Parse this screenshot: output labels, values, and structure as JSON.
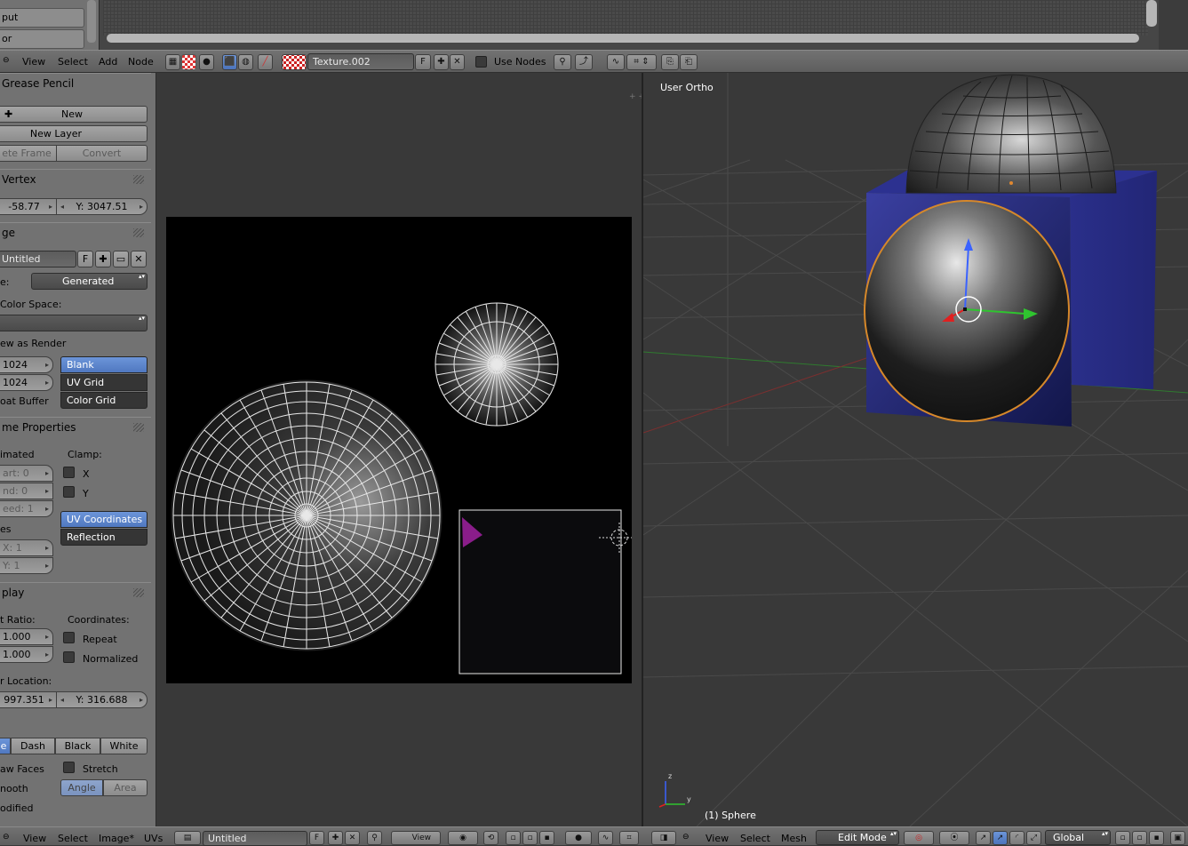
{
  "top_left": {
    "items": [
      "put",
      "or"
    ]
  },
  "texture_header": {
    "menus": [
      "View",
      "Select",
      "Add",
      "Node"
    ],
    "texture_name": "Texture.002",
    "fake_user": "F",
    "use_nodes": "Use Nodes"
  },
  "panel": {
    "grease_pencil": {
      "title": "Grease Pencil",
      "new": "New",
      "new_layer": "New Layer",
      "delete_frame": "ete Frame",
      "convert": "Convert"
    },
    "uv_vertex": {
      "title": "Vertex",
      "x": "-58.77",
      "y": "Y: 3047.51"
    },
    "image": {
      "title": "ge",
      "name": "Untitled",
      "fake_user": "F",
      "source_label": "e:",
      "source_value": "Generated",
      "color_space_label": "Color Space:",
      "view_as_render": "ew as Render",
      "width": "1024",
      "height": "1024",
      "float_buffer": "oat Buffer",
      "gen_types": [
        "Blank",
        "UV Grid",
        "Color Grid"
      ],
      "gen_selected": "Blank"
    },
    "game_properties": {
      "title": "me Properties",
      "animated": "imated",
      "start": "art: 0",
      "end": "nd: 0",
      "speed": "eed: 1",
      "clamp": "Clamp:",
      "clamp_x": "X",
      "clamp_y": "Y",
      "mapping": [
        "UV Coordinates",
        "Reflection"
      ],
      "tiles": "es",
      "tiles_x": "X: 1",
      "tiles_y": "Y: 1"
    },
    "display": {
      "title": "play",
      "aspect_ratio": "t Ratio:",
      "aspect_x": "1.000",
      "aspect_y": "1.000",
      "coordinates": "Coordinates:",
      "repeat": "Repeat",
      "normalized": "Normalized",
      "cursor_location": "r Location:",
      "cursor_x": "997.351",
      "cursor_y": "Y: 316.688",
      "edge_styles": [
        "e",
        "Dash",
        "Black",
        "White"
      ],
      "draw_faces": "aw Faces",
      "stretch": "Stretch",
      "smooth": "nooth",
      "stretch_modes": [
        "Angle",
        "Area"
      ],
      "modified": "odified"
    }
  },
  "viewport": {
    "view_label": "User Ortho",
    "object_label": "(1) Sphere",
    "axis_x": "y",
    "axis_z": "z"
  },
  "bottom_left": {
    "menus": [
      "View",
      "Select",
      "Image*",
      "UVs"
    ],
    "image_name": "Untitled",
    "fake_user": "F",
    "view_dropdown": "View"
  },
  "bottom_right": {
    "menus": [
      "View",
      "Select",
      "Mesh"
    ],
    "mode": "Edit Mode",
    "orientation": "Global"
  },
  "colors": {
    "accent_blue": "#5b84cc",
    "panel_bg": "#727272",
    "viewport_bg": "#393939",
    "cube_blue": "#2a2f8a",
    "magenta": "#8a1d8a"
  }
}
